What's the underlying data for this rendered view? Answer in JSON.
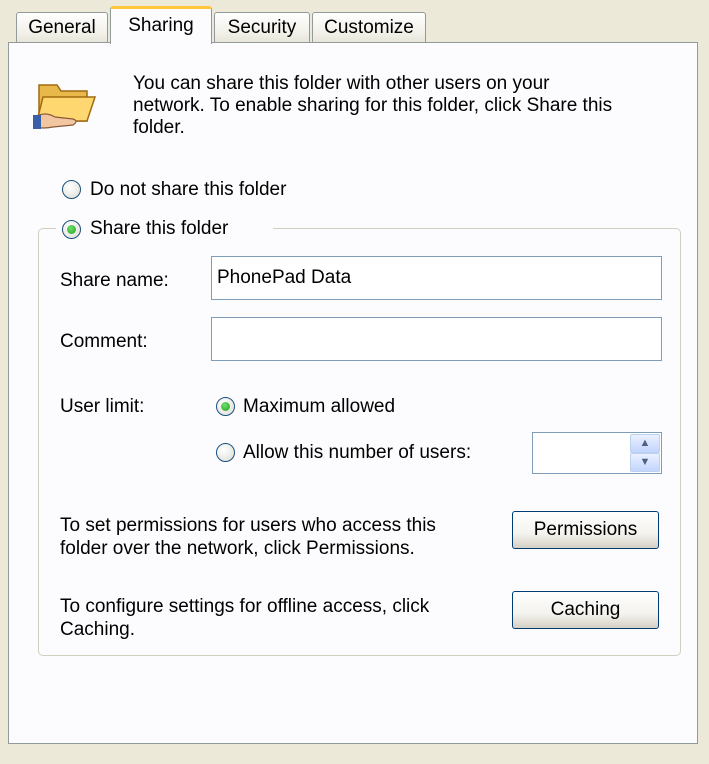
{
  "tabs": [
    {
      "label": "General",
      "active": false
    },
    {
      "label": "Sharing",
      "active": true
    },
    {
      "label": "Security",
      "active": false
    },
    {
      "label": "Customize",
      "active": false
    }
  ],
  "intro": {
    "line1": "You can share this folder with other users on your",
    "line2": "network.  To enable sharing for this folder, click Share this",
    "line3": "folder.",
    "icon": "folder-share-icon"
  },
  "sharing_options": {
    "do_not_share": {
      "label": "Do not share this folder",
      "selected": false
    },
    "share": {
      "label": "Share this folder",
      "selected": true
    }
  },
  "share_name": {
    "label": "Share name:",
    "value": "PhonePad Data"
  },
  "comment": {
    "label": "Comment:",
    "value": ""
  },
  "user_limit": {
    "label": "User limit:",
    "maximum": {
      "label": "Maximum allowed",
      "selected": true
    },
    "allow_number": {
      "label": "Allow this number of users:",
      "selected": false
    },
    "count_value": ""
  },
  "permissions": {
    "line1": "To set permissions for users who access this",
    "line2": "folder over the network, click Permissions.",
    "button": "Permissions"
  },
  "caching": {
    "line1": "To configure settings for offline access, click",
    "line2": "Caching.",
    "button": "Caching"
  },
  "colors": {
    "dialog_bg": "#ece9d8",
    "panel_bg": "#fcfcfe",
    "active_tab_accent": "#ffc83c",
    "radio_selected": "#21a121",
    "button_border": "#003c74"
  }
}
